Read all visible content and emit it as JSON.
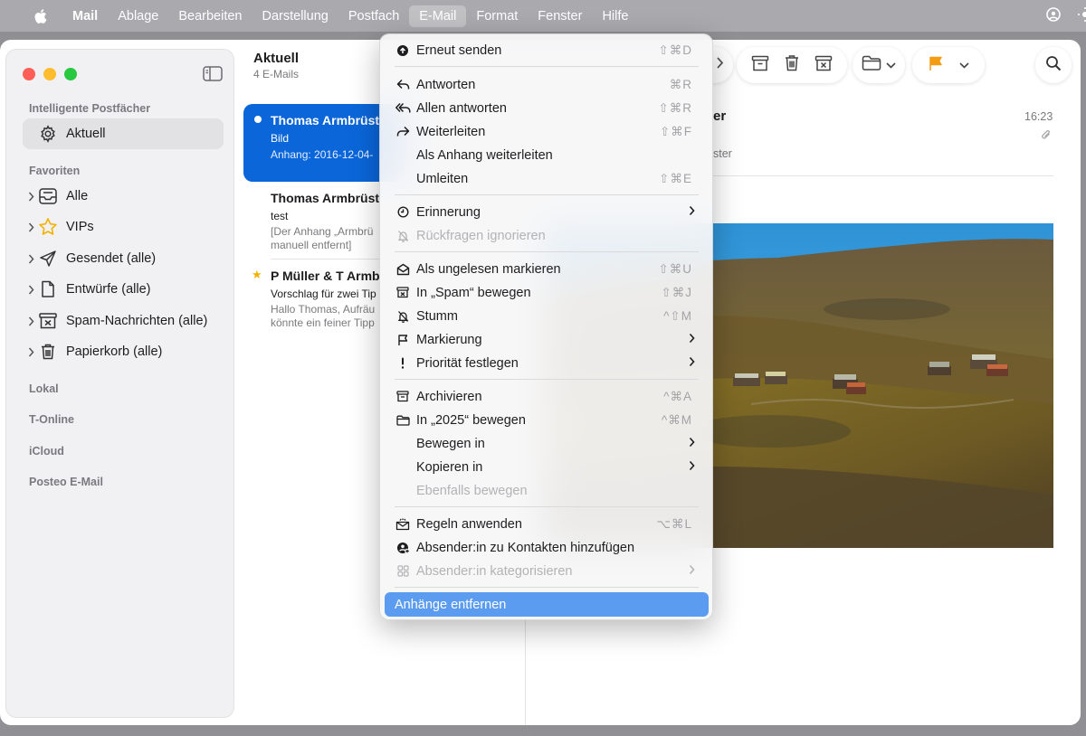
{
  "menubar": {
    "app": "Mail",
    "items": [
      "Ablage",
      "Bearbeiten",
      "Darstellung",
      "Postfach",
      "E-Mail",
      "Format",
      "Fenster",
      "Hilfe"
    ],
    "active": "E-Mail"
  },
  "sidebar": {
    "sections": {
      "smart": "Intelligente Postfächer",
      "favorites": "Favoriten",
      "local": "Lokal",
      "tonline": "T-Online",
      "icloud": "iCloud",
      "posteo": "Posteo E-Mail"
    },
    "smart_items": [
      {
        "label": "Aktuell",
        "icon": "gear-icon",
        "selected": true
      }
    ],
    "favorite_items": [
      {
        "label": "Alle",
        "icon": "inbox-tray-icon"
      },
      {
        "label": "VIPs",
        "icon": "star-icon"
      },
      {
        "label": "Gesendet (alle)",
        "icon": "paperplane-icon"
      },
      {
        "label": "Entwürfe (alle)",
        "icon": "document-icon"
      },
      {
        "label": "Spam-Nachrichten (alle)",
        "icon": "junk-box-icon"
      },
      {
        "label": "Papierkorb (alle)",
        "icon": "trash-icon"
      }
    ]
  },
  "list": {
    "title": "Aktuell",
    "count": "4 E-Mails",
    "messages": [
      {
        "from": "Thomas Armbrüst",
        "subject": "Bild",
        "preview1": "Anhang: 2016-12-04-",
        "preview2": "",
        "unread": true,
        "flag": "",
        "selected": true
      },
      {
        "from": "Thomas Armbrüst",
        "subject": "test",
        "preview1": "[Der Anhang „Armbrü",
        "preview2": "manuell entfernt]",
        "unread": false,
        "flag": "",
        "selected": false
      },
      {
        "from": "P Müller & T Armb",
        "subject": "Vorschlag für zwei Tip",
        "preview1": "Hallo Thomas, Aufräu",
        "preview2": "könnte ein feiner Tipp",
        "unread": false,
        "flag": "★",
        "selected": false
      }
    ]
  },
  "reader": {
    "sender_tail": "er",
    "recipient_tail": "ster",
    "time": "16:23",
    "toolbar_icons": [
      "chevron-right-icon",
      "archive-icon",
      "trash-icon",
      "junk-icon",
      "folder-icon",
      "chevron-down-icon",
      "flag-icon",
      "chevron-down-icon",
      "search-icon"
    ],
    "accent_flag": "#f39c12"
  },
  "menu": {
    "items": [
      {
        "label": "Erneut senden",
        "shortcut": "⇧⌘D",
        "icon": "resend-icon"
      },
      {
        "label": "Antworten",
        "shortcut": "⌘R",
        "icon": "reply-icon"
      },
      {
        "label": "Allen antworten",
        "shortcut": "⇧⌘R",
        "icon": "reply-all-icon"
      },
      {
        "label": "Weiterleiten",
        "shortcut": "⇧⌘F",
        "icon": "forward-icon"
      },
      {
        "label": "Als Anhang weiterleiten",
        "shortcut": "",
        "icon": ""
      },
      {
        "label": "Umleiten",
        "shortcut": "⇧⌘E",
        "icon": ""
      },
      {
        "label": "Erinnerung",
        "shortcut": "",
        "icon": "clock-icon",
        "submenu": true
      },
      {
        "label": "Rückfragen ignorieren",
        "shortcut": "",
        "icon": "bell-slash-icon",
        "disabled": true
      },
      {
        "label": "Als ungelesen markieren",
        "shortcut": "⇧⌘U",
        "icon": "envelope-open-icon"
      },
      {
        "label": "In „Spam“ bewegen",
        "shortcut": "⇧⌘J",
        "icon": "junk-box-icon"
      },
      {
        "label": "Stumm",
        "shortcut": "^⇧M",
        "icon": "bell-mute-icon"
      },
      {
        "label": "Markierung",
        "shortcut": "",
        "icon": "flag-outline-icon",
        "submenu": true
      },
      {
        "label": "Priorität festlegen",
        "shortcut": "",
        "icon": "exclamation-icon",
        "submenu": true
      },
      {
        "label": "Archivieren",
        "shortcut": "^⌘A",
        "icon": "archive-icon"
      },
      {
        "label": "In „2025“ bewegen",
        "shortcut": "^⌘M",
        "icon": "folder-icon"
      },
      {
        "label": "Bewegen in",
        "shortcut": "",
        "icon": "",
        "submenu": true
      },
      {
        "label": "Kopieren in",
        "shortcut": "",
        "icon": "",
        "submenu": true
      },
      {
        "label": "Ebenfalls bewegen",
        "shortcut": "",
        "icon": "",
        "disabled": true
      },
      {
        "label": "Regeln anwenden",
        "shortcut": "⌥⌘L",
        "icon": "rules-envelope-icon"
      },
      {
        "label": "Absender:in zu Kontakten hinzufügen",
        "shortcut": "",
        "icon": "add-contact-icon"
      },
      {
        "label": "Absender:in kategorisieren",
        "shortcut": "",
        "icon": "categorize-icon",
        "disabled": true,
        "submenu": true
      },
      {
        "label": "Anhänge entfernen",
        "shortcut": "",
        "icon": "",
        "highlighted": true
      }
    ]
  }
}
